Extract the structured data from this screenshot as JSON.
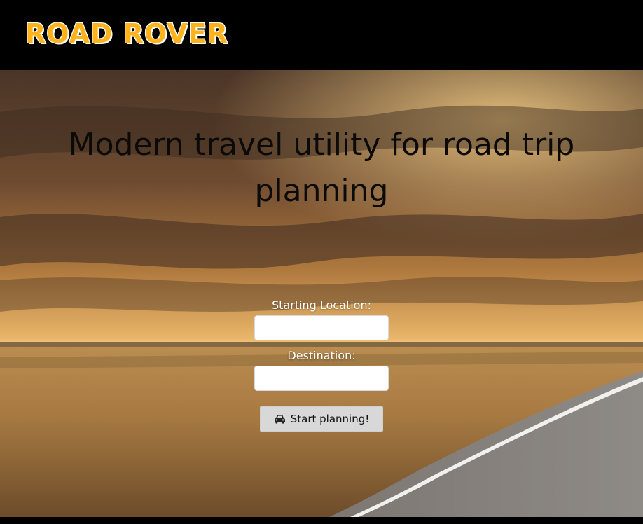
{
  "header": {
    "brand": "ROAD ROVER"
  },
  "hero": {
    "headline": "Modern travel utility for road trip planning"
  },
  "form": {
    "start_label": "Starting Location:",
    "start_value": "",
    "destination_label": "Destination:",
    "destination_value": "",
    "submit_label": "Start planning!",
    "submit_icon": "car-icon"
  },
  "colors": {
    "brand": "#ffb31a",
    "header_bg": "#000000",
    "button_bg": "#d8d8d8"
  }
}
